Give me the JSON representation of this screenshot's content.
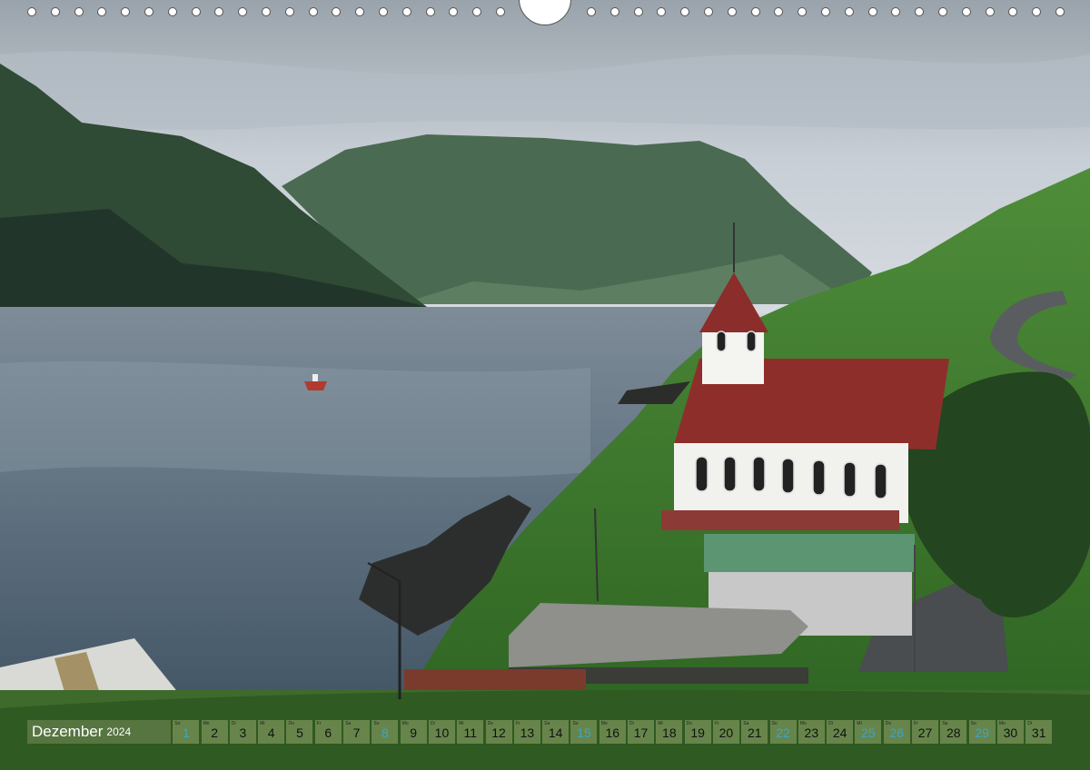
{
  "calendar": {
    "month": "Dezember",
    "year": "2024",
    "weekend_color": "#3aa6c9",
    "days": [
      {
        "n": "1",
        "wd": "So",
        "we": true
      },
      {
        "n": "2",
        "wd": "Mo",
        "we": false
      },
      {
        "n": "3",
        "wd": "Di",
        "we": false
      },
      {
        "n": "4",
        "wd": "Mi",
        "we": false
      },
      {
        "n": "5",
        "wd": "Do",
        "we": false
      },
      {
        "n": "6",
        "wd": "Fr",
        "we": false
      },
      {
        "n": "7",
        "wd": "Sa",
        "we": false
      },
      {
        "n": "8",
        "wd": "So",
        "we": true
      },
      {
        "n": "9",
        "wd": "Mo",
        "we": false
      },
      {
        "n": "10",
        "wd": "Di",
        "we": false
      },
      {
        "n": "11",
        "wd": "Mi",
        "we": false
      },
      {
        "n": "12",
        "wd": "Do",
        "we": false
      },
      {
        "n": "13",
        "wd": "Fr",
        "we": false
      },
      {
        "n": "14",
        "wd": "Sa",
        "we": false
      },
      {
        "n": "15",
        "wd": "So",
        "we": true
      },
      {
        "n": "16",
        "wd": "Mo",
        "we": false
      },
      {
        "n": "17",
        "wd": "Di",
        "we": false
      },
      {
        "n": "18",
        "wd": "Mi",
        "we": false
      },
      {
        "n": "19",
        "wd": "Do",
        "we": false
      },
      {
        "n": "20",
        "wd": "Fr",
        "we": false
      },
      {
        "n": "21",
        "wd": "Sa",
        "we": false
      },
      {
        "n": "22",
        "wd": "So",
        "we": true
      },
      {
        "n": "23",
        "wd": "Mo",
        "we": false
      },
      {
        "n": "24",
        "wd": "Di",
        "we": false
      },
      {
        "n": "25",
        "wd": "Mi",
        "we": true
      },
      {
        "n": "26",
        "wd": "Do",
        "we": true
      },
      {
        "n": "27",
        "wd": "Fr",
        "we": false
      },
      {
        "n": "28",
        "wd": "Sa",
        "we": false
      },
      {
        "n": "29",
        "wd": "So",
        "we": true
      },
      {
        "n": "30",
        "wd": "Mo",
        "we": false
      },
      {
        "n": "31",
        "wd": "Di",
        "we": false
      }
    ]
  }
}
